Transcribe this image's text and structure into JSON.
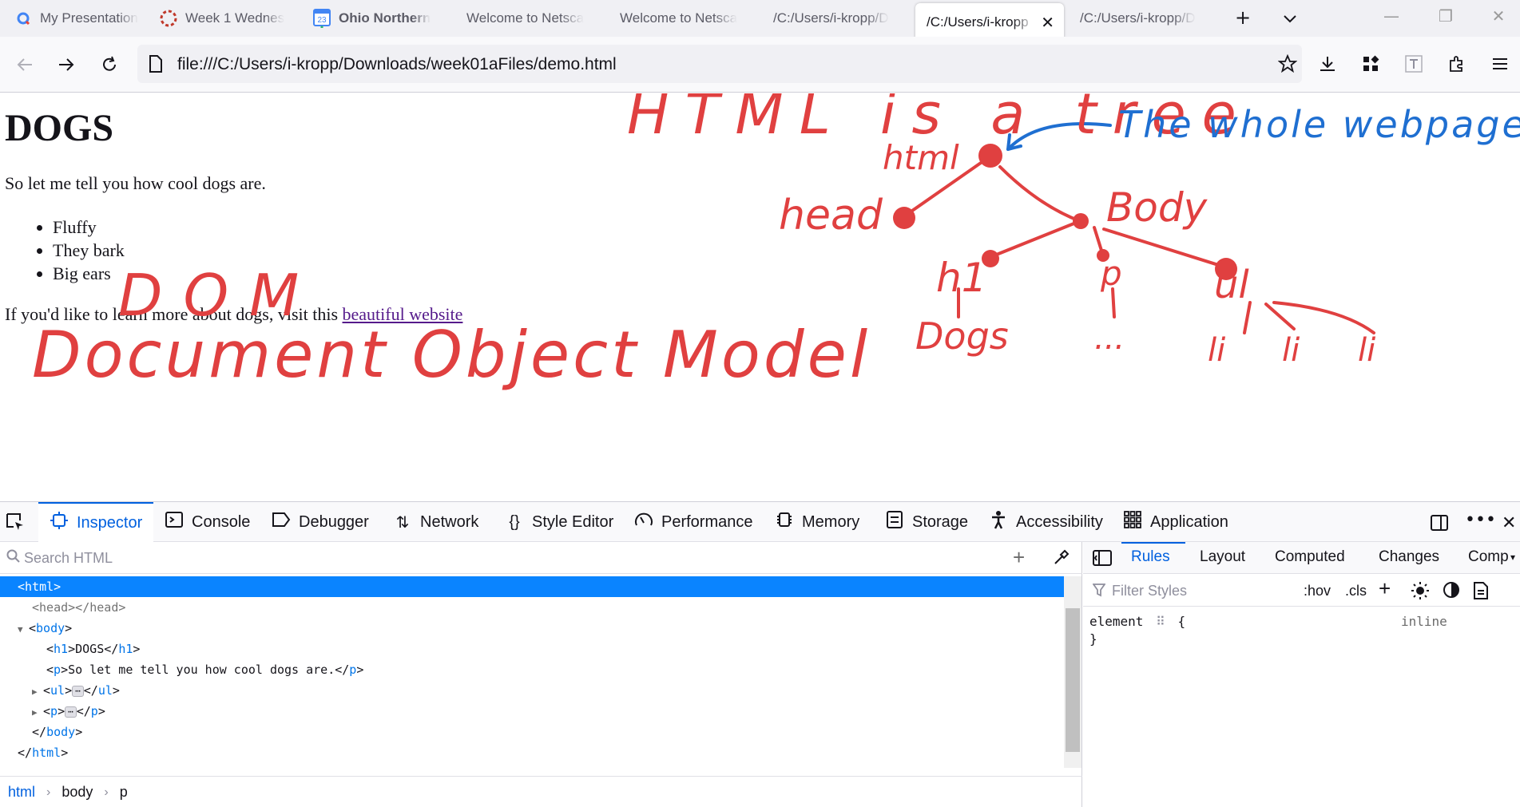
{
  "tabs": [
    {
      "title": "My Presentation",
      "icon": "google-slides-icon"
    },
    {
      "title": "Week 1 Wednes",
      "icon": "circle-dashed-icon"
    },
    {
      "title": "Ohio Northern",
      "icon": "calendar-icon"
    },
    {
      "title": "Welcome to Netsca",
      "icon": ""
    },
    {
      "title": "Welcome to Netsca",
      "icon": ""
    },
    {
      "title": "/C:/Users/i-kropp/D",
      "icon": ""
    },
    {
      "title": "/C:/Users/i-kropp",
      "icon": ""
    },
    {
      "title": "/C:/Users/i-kropp/D",
      "icon": ""
    }
  ],
  "calendar_day": "23",
  "url": "file:///C:/Users/i-kropp/Downloads/week01aFiles/demo.html",
  "page": {
    "heading": "DOGS",
    "intro": "So let me tell you how cool dogs are.",
    "items": [
      "Fluffy",
      "They bark",
      "Big ears"
    ],
    "outro": "If you'd like to learn more about dogs, visit this ",
    "link": "beautiful website"
  },
  "annotations": {
    "tree_title": "HTML is a tree",
    "whole_page": "The whole webpage",
    "html": "html",
    "head": "head",
    "body": "Body",
    "h1": "h1",
    "p": "p",
    "ul": "ul",
    "dogs": "Dogs",
    "dots": "...",
    "li1": "li",
    "li2": "li",
    "li3": "li",
    "dom": "DOM",
    "dom_full": "Document Object Model"
  },
  "colors": {
    "ink_red": "#e04040",
    "ink_blue": "#1f6fd1",
    "accent": "#0060df",
    "selection": "#0a84ff"
  },
  "devtools": {
    "tabs": [
      "Inspector",
      "Console",
      "Debugger",
      "Network",
      "Style Editor",
      "Performance",
      "Memory",
      "Storage",
      "Accessibility",
      "Application"
    ],
    "search_placeholder": "Search HTML",
    "tree": {
      "html_open": "html",
      "head": "<head></head>",
      "body_open": "body",
      "h1_text": "DOGS",
      "p_text": "So let me tell you how cool dogs are.",
      "ul": "ul",
      "p": "p",
      "body_close": "body",
      "html_close": "html",
      "ellipsis": "⋯"
    },
    "breadcrumbs": [
      "html",
      "body",
      "p"
    ],
    "side_tabs": [
      "Rules",
      "Layout",
      "Computed",
      "Changes",
      "Comp"
    ],
    "filter_placeholder": "Filter Styles",
    "hov": ":hov",
    "cls": ".cls",
    "rule_selector": "element",
    "rule_open": "{",
    "rule_close": "}",
    "rule_source": "inline"
  }
}
